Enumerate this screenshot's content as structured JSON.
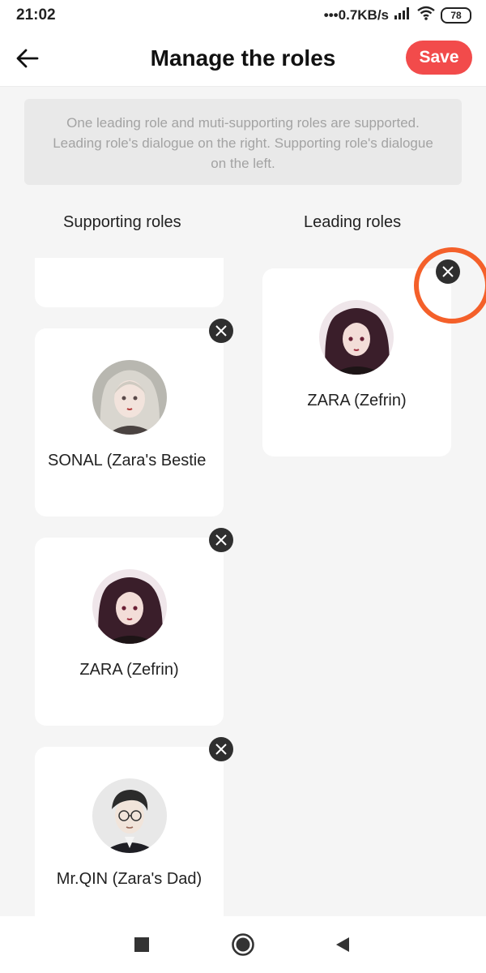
{
  "status": {
    "time": "21:02",
    "network_speed": "•••0.7KB/s",
    "battery": "78"
  },
  "header": {
    "title": "Manage the roles",
    "save_label": "Save",
    "accent": "#f24b4b"
  },
  "info": {
    "text": "One leading role and muti-supporting roles are supported. Leading role's dialogue on the right. Supporting role's dialogue on the left."
  },
  "columns": {
    "supporting_title": "Supporting roles",
    "leading_title": "Leading roles"
  },
  "supporting_roles": [
    {
      "name": "",
      "avatar": "partial-card"
    },
    {
      "name": "SONAL (Zara's Bestie",
      "avatar": "silver-hair-girl"
    },
    {
      "name": "ZARA (Zefrin)",
      "avatar": "dark-hair-girl"
    },
    {
      "name": "Mr.QIN (Zara's Dad)",
      "avatar": "glasses-man"
    }
  ],
  "leading_roles": [
    {
      "name": "ZARA (Zefrin)",
      "avatar": "dark-hair-girl"
    }
  ],
  "nav": {
    "icons": [
      "recent-apps-icon",
      "home-icon",
      "back-icon"
    ]
  }
}
